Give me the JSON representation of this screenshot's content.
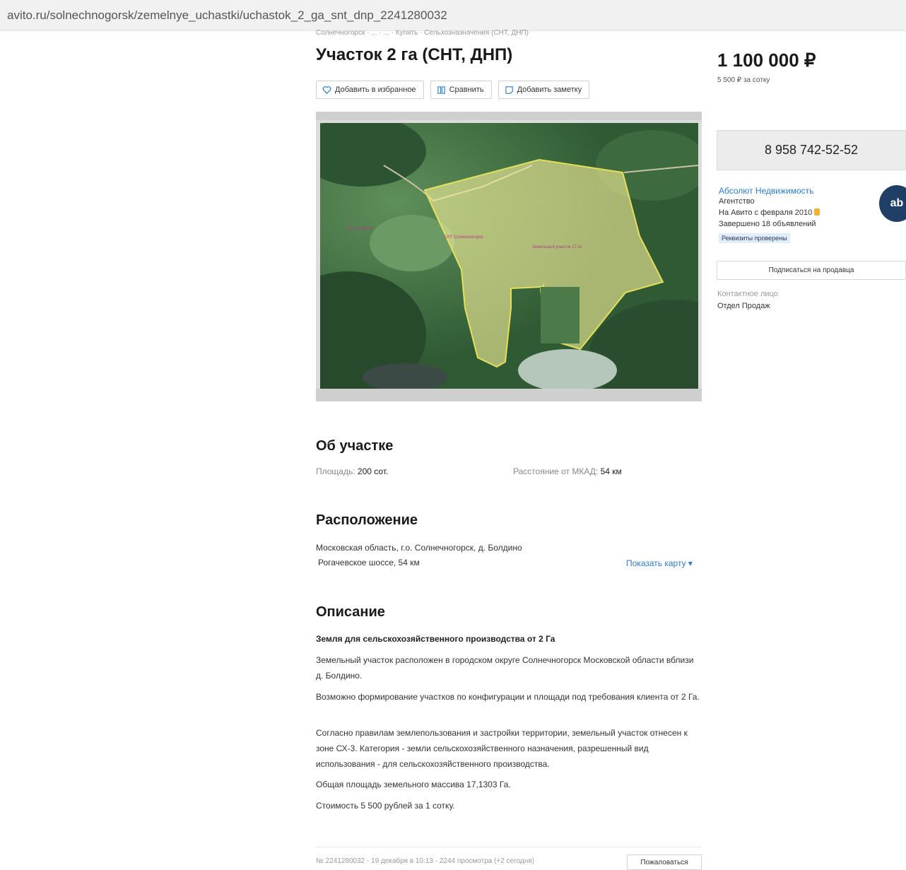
{
  "browser": {
    "url": "avito.ru/solnechnogorsk/zemelnye_uchastki/uchastok_2_ga_snt_dnp_2241280032"
  },
  "breadcrumb": "Солнечногорск · ... · ... · Купить · Сельхозназначения (СНТ, ДНП)",
  "listing": {
    "title": "Участок 2 га (СНТ, ДНП)",
    "actions": {
      "favorite": "Добавить в избранное",
      "compare": "Сравнить",
      "note": "Добавить заметку"
    },
    "map_labels": {
      "left": "СНТ Болдино",
      "middle": "СНТ Солнечногорск",
      "plot": "Земельный участок 17 га"
    }
  },
  "price": {
    "value": "1 100 000 ₽",
    "per_unit": "5 500 ₽ за сотку"
  },
  "phone": "8 958 742-52-52",
  "seller": {
    "name": "Абсолют Недвижимость",
    "type": "Агентство",
    "since": "На Авито с февраля 2010",
    "completed": "Завершено 18 объявлений",
    "badge": "Реквизиты проверены",
    "avatar_text": "ab",
    "subscribe": "Подписаться на продавца",
    "contact_label": "Контактное лицо",
    "contact_value": "Отдел Продаж"
  },
  "about": {
    "heading": "Об участке",
    "area_key": "Площадь:",
    "area_value": "200 сот.",
    "distance_key": "Расстояние от МКАД:",
    "distance_value": "54 км"
  },
  "location": {
    "heading": "Расположение",
    "line1": "Московская область, г.о. Солнечногорск, д. Болдино",
    "line2": "Рогачевское шоссе, 54 км",
    "show_map": "Показать карту"
  },
  "description": {
    "heading": "Описание",
    "p1": "Земля для сельскохозяйственного производства от 2 Га",
    "p2": "Земельный участок расположен в городском округе Солнечногорск Московской области вблизи д. Болдино.",
    "p3": "Возможно формирование участков по конфигурации и площади под требования клиента от 2 Га.",
    "p4": "Согласно правилам землепользования и застройки территории, земельный участок отнесен к зоне СХ-3. Категория - земли сельскохозяйственного назначения, разрешенный вид использования - для сельскохозяйственного производства.",
    "p5": "Общая площадь земельного массива 17,1303 Га.",
    "p6": "Стоимость 5 500 рублей за 1 сотку."
  },
  "footer": {
    "meta": "№ 2241280032 · 19 декабря в 10:13 · 2244 просмотра (+2 сегодня)",
    "complain": "Пожаловаться"
  },
  "colors": {
    "link": "#2b7bd0",
    "plot_fill": "#f3ef9a",
    "avatar_bg": "#1f3f66"
  }
}
